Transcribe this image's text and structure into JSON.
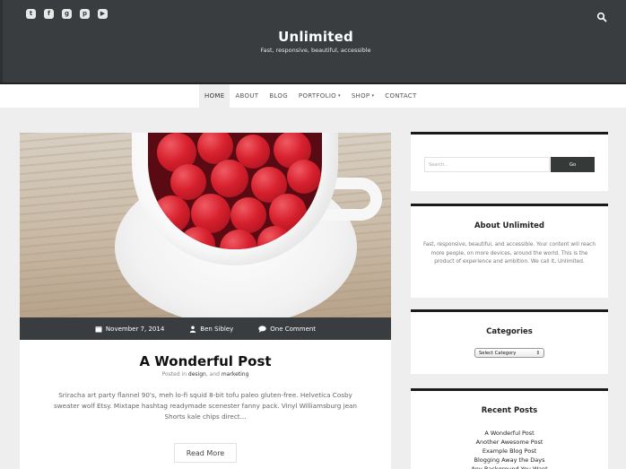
{
  "header": {
    "site_title": "Unlimited",
    "tagline": "Fast, responsive, beautiful, accessible",
    "social_icons": [
      "twitter-icon",
      "facebook-icon",
      "google-plus-icon",
      "pinterest-icon",
      "youtube-icon"
    ],
    "search_icon": "search-icon",
    "background_color": "#3a3d40"
  },
  "nav": {
    "items": [
      {
        "label": "HOME",
        "active": true,
        "has_dropdown": false
      },
      {
        "label": "ABOUT",
        "active": false,
        "has_dropdown": false
      },
      {
        "label": "BLOG",
        "active": false,
        "has_dropdown": false
      },
      {
        "label": "PORTFOLIO",
        "active": false,
        "has_dropdown": true
      },
      {
        "label": "SHOP",
        "active": false,
        "has_dropdown": true
      },
      {
        "label": "CONTACT",
        "active": false,
        "has_dropdown": false
      }
    ],
    "caret": "▾"
  },
  "post": {
    "image_alt": "Cup of raspberries on wooden table",
    "date": "November 7, 2014",
    "author": "Ben Sibley",
    "comments": "One Comment",
    "title": "A Wonderful Post",
    "posted_in_prefix": "Posted in ",
    "categories": [
      "design",
      "marketing"
    ],
    "categories_joiner": ", and ",
    "excerpt": "Sriracha art party flannel 90's, meh lo-fi squid 8-bit tofu paleo gluten-free. Helvetica Cosby sweater wolf Etsy. Mixtape hashtag readymade scenester fanny pack. Vinyl Williamsburg jean Shorts kale chips direct...",
    "read_more_label": "Read More"
  },
  "sidebar": {
    "search": {
      "placeholder": "Search...",
      "button_label": "Go"
    },
    "about": {
      "title": "About Unlimited",
      "text": "Fast, responsive, beautiful, and accessible. Your content will reach more people, on more devices, around the world. This is the product of experience and ambition. We call it, Unlimited."
    },
    "categories": {
      "title": "Categories",
      "selected": "Select Category",
      "arrow": "⇕"
    },
    "recent_posts": {
      "title": "Recent Posts",
      "items": [
        "A Wonderful Post",
        "Another Awesome Post",
        "Example Blog Post",
        "Blogging Away the Days",
        "Any Background You Want"
      ]
    }
  },
  "colors": {
    "header_bg": "#3a3d40",
    "meta_bar_bg": "#3a3d40",
    "page_bg": "#eeeeee",
    "widget_border": "#1a1a1a",
    "search_button": "#353a38"
  }
}
